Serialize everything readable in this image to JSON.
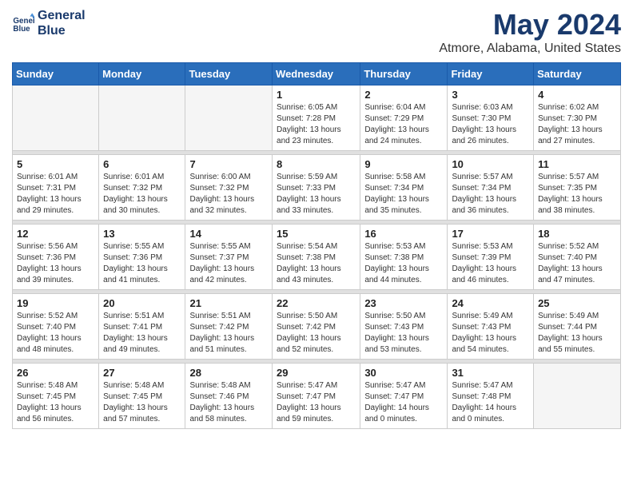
{
  "logo": {
    "line1": "General",
    "line2": "Blue"
  },
  "title": "May 2024",
  "location": "Atmore, Alabama, United States",
  "weekdays": [
    "Sunday",
    "Monday",
    "Tuesday",
    "Wednesday",
    "Thursday",
    "Friday",
    "Saturday"
  ],
  "weeks": [
    [
      {
        "day": "",
        "info": ""
      },
      {
        "day": "",
        "info": ""
      },
      {
        "day": "",
        "info": ""
      },
      {
        "day": "1",
        "info": "Sunrise: 6:05 AM\nSunset: 7:28 PM\nDaylight: 13 hours\nand 23 minutes."
      },
      {
        "day": "2",
        "info": "Sunrise: 6:04 AM\nSunset: 7:29 PM\nDaylight: 13 hours\nand 24 minutes."
      },
      {
        "day": "3",
        "info": "Sunrise: 6:03 AM\nSunset: 7:30 PM\nDaylight: 13 hours\nand 26 minutes."
      },
      {
        "day": "4",
        "info": "Sunrise: 6:02 AM\nSunset: 7:30 PM\nDaylight: 13 hours\nand 27 minutes."
      }
    ],
    [
      {
        "day": "5",
        "info": "Sunrise: 6:01 AM\nSunset: 7:31 PM\nDaylight: 13 hours\nand 29 minutes."
      },
      {
        "day": "6",
        "info": "Sunrise: 6:01 AM\nSunset: 7:32 PM\nDaylight: 13 hours\nand 30 minutes."
      },
      {
        "day": "7",
        "info": "Sunrise: 6:00 AM\nSunset: 7:32 PM\nDaylight: 13 hours\nand 32 minutes."
      },
      {
        "day": "8",
        "info": "Sunrise: 5:59 AM\nSunset: 7:33 PM\nDaylight: 13 hours\nand 33 minutes."
      },
      {
        "day": "9",
        "info": "Sunrise: 5:58 AM\nSunset: 7:34 PM\nDaylight: 13 hours\nand 35 minutes."
      },
      {
        "day": "10",
        "info": "Sunrise: 5:57 AM\nSunset: 7:34 PM\nDaylight: 13 hours\nand 36 minutes."
      },
      {
        "day": "11",
        "info": "Sunrise: 5:57 AM\nSunset: 7:35 PM\nDaylight: 13 hours\nand 38 minutes."
      }
    ],
    [
      {
        "day": "12",
        "info": "Sunrise: 5:56 AM\nSunset: 7:36 PM\nDaylight: 13 hours\nand 39 minutes."
      },
      {
        "day": "13",
        "info": "Sunrise: 5:55 AM\nSunset: 7:36 PM\nDaylight: 13 hours\nand 41 minutes."
      },
      {
        "day": "14",
        "info": "Sunrise: 5:55 AM\nSunset: 7:37 PM\nDaylight: 13 hours\nand 42 minutes."
      },
      {
        "day": "15",
        "info": "Sunrise: 5:54 AM\nSunset: 7:38 PM\nDaylight: 13 hours\nand 43 minutes."
      },
      {
        "day": "16",
        "info": "Sunrise: 5:53 AM\nSunset: 7:38 PM\nDaylight: 13 hours\nand 44 minutes."
      },
      {
        "day": "17",
        "info": "Sunrise: 5:53 AM\nSunset: 7:39 PM\nDaylight: 13 hours\nand 46 minutes."
      },
      {
        "day": "18",
        "info": "Sunrise: 5:52 AM\nSunset: 7:40 PM\nDaylight: 13 hours\nand 47 minutes."
      }
    ],
    [
      {
        "day": "19",
        "info": "Sunrise: 5:52 AM\nSunset: 7:40 PM\nDaylight: 13 hours\nand 48 minutes."
      },
      {
        "day": "20",
        "info": "Sunrise: 5:51 AM\nSunset: 7:41 PM\nDaylight: 13 hours\nand 49 minutes."
      },
      {
        "day": "21",
        "info": "Sunrise: 5:51 AM\nSunset: 7:42 PM\nDaylight: 13 hours\nand 51 minutes."
      },
      {
        "day": "22",
        "info": "Sunrise: 5:50 AM\nSunset: 7:42 PM\nDaylight: 13 hours\nand 52 minutes."
      },
      {
        "day": "23",
        "info": "Sunrise: 5:50 AM\nSunset: 7:43 PM\nDaylight: 13 hours\nand 53 minutes."
      },
      {
        "day": "24",
        "info": "Sunrise: 5:49 AM\nSunset: 7:43 PM\nDaylight: 13 hours\nand 54 minutes."
      },
      {
        "day": "25",
        "info": "Sunrise: 5:49 AM\nSunset: 7:44 PM\nDaylight: 13 hours\nand 55 minutes."
      }
    ],
    [
      {
        "day": "26",
        "info": "Sunrise: 5:48 AM\nSunset: 7:45 PM\nDaylight: 13 hours\nand 56 minutes."
      },
      {
        "day": "27",
        "info": "Sunrise: 5:48 AM\nSunset: 7:45 PM\nDaylight: 13 hours\nand 57 minutes."
      },
      {
        "day": "28",
        "info": "Sunrise: 5:48 AM\nSunset: 7:46 PM\nDaylight: 13 hours\nand 58 minutes."
      },
      {
        "day": "29",
        "info": "Sunrise: 5:47 AM\nSunset: 7:47 PM\nDaylight: 13 hours\nand 59 minutes."
      },
      {
        "day": "30",
        "info": "Sunrise: 5:47 AM\nSunset: 7:47 PM\nDaylight: 14 hours\nand 0 minutes."
      },
      {
        "day": "31",
        "info": "Sunrise: 5:47 AM\nSunset: 7:48 PM\nDaylight: 14 hours\nand 0 minutes."
      },
      {
        "day": "",
        "info": ""
      }
    ]
  ]
}
